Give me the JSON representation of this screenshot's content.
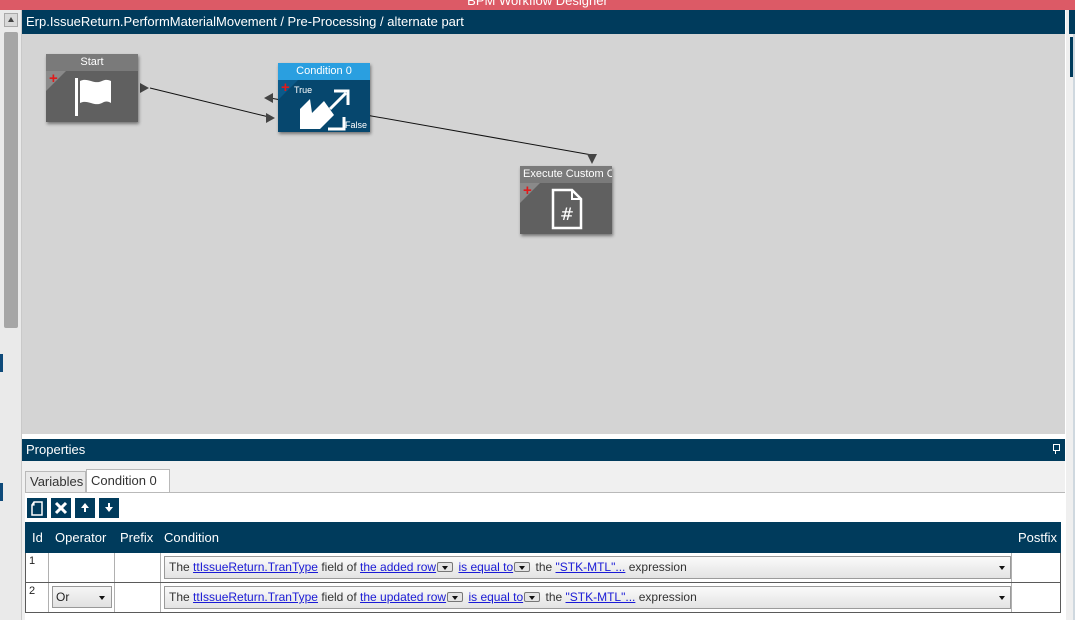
{
  "window": {
    "title": "BPM Workflow Designer"
  },
  "canvas": {
    "breadcrumb": "Erp.IssueReturn.PerformMaterialMovement / Pre-Processing / alternate part",
    "nodes": {
      "start": {
        "title": "Start"
      },
      "condition": {
        "title": "Condition 0",
        "true_label": "True",
        "false_label": "False"
      },
      "execute": {
        "title": "Execute Custom Code"
      }
    }
  },
  "properties": {
    "title": "Properties",
    "tabs": [
      {
        "label": "Variables"
      },
      {
        "label": "Condition 0"
      }
    ],
    "active_tab": "Condition 0",
    "toolbar": {
      "new_icon": "new-document-icon",
      "delete_icon": "delete-x-icon",
      "up_icon": "arrow-up-icon",
      "down_icon": "arrow-down-icon"
    },
    "grid": {
      "columns": {
        "id": "Id",
        "operator": "Operator",
        "prefix": "Prefix",
        "condition": "Condition",
        "postfix": "Postfix"
      },
      "rows": [
        {
          "id": "1",
          "operator": "",
          "condition": {
            "t1": "The",
            "field": "ttIssueReturn.TranType",
            "t2": "field of",
            "row": "the added row",
            "comparison": "is equal to",
            "t3": "the",
            "value": "\"STK-MTL\"...",
            "t4": "expression"
          }
        },
        {
          "id": "2",
          "operator": "Or",
          "condition": {
            "t1": "The",
            "field": "ttIssueReturn.TranType",
            "t2": "field of",
            "row": "the updated row",
            "comparison": "is equal to",
            "t3": "the",
            "value": "\"STK-MTL\"...",
            "t4": "expression"
          }
        }
      ]
    }
  },
  "colors": {
    "header_navy": "#003b5c",
    "condition_accent": "#2a9fe0",
    "titlebar": "#dc5a66",
    "add_plus": "#e01a1a"
  }
}
